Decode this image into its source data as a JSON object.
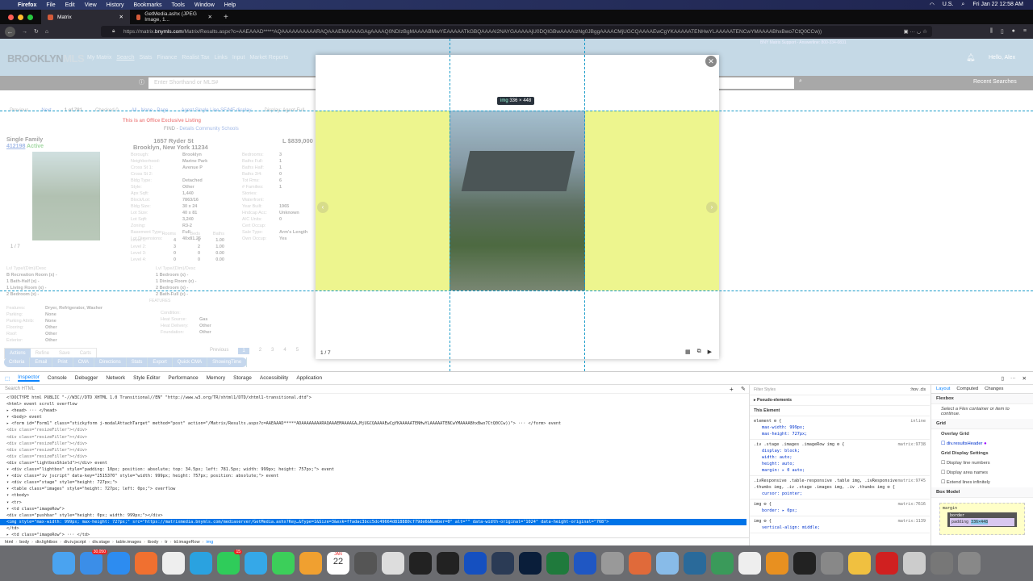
{
  "menubar": {
    "items": [
      "Firefox",
      "File",
      "Edit",
      "View",
      "History",
      "Bookmarks",
      "Tools",
      "Window",
      "Help"
    ],
    "locale": "U.S.",
    "clock": "Fri Jan 22  12:58 AM"
  },
  "tabs": [
    {
      "label": "Matrix"
    },
    {
      "label": "GetMedia.ashx (JPEG Image, 1..."
    }
  ],
  "url": {
    "prefix": "https://matrix.",
    "host": "bnymls.com",
    "path": "/Matrix/Results.aspx?c=AAEAAAD*****AQAAAAAAAAAARAQAAAEMAAAAGAgAAAAQ0NDIzBgMAAAABMwYEAAAAATkGBQAAAAI2NAYGAAAAAjU0DQIGBwAAAAIzNg0JBggAAAACMjUGCQAAAAEwCgYKAAAAATENHwYLAAAAATENCwYMAAAABhxBwo7CtQ0CCw))"
  },
  "header": {
    "logo_a": "BROOKLYN",
    "logo_b": "MLS",
    "nav": [
      "My Matrix",
      "Search",
      "Stats",
      "Finance",
      "Realist Tax",
      "Links",
      "Input",
      "Market Reports"
    ],
    "support": "BNY Matrix Support - Answerline: 800-334-0831",
    "user": "Hello, Alex",
    "search_placeholder": "Enter Shorthand or MLS#",
    "recent": "Recent Searches"
  },
  "results": {
    "pager": [
      "Previous",
      "Next",
      "1 of 781",
      "Checked 0",
      "All · None · Page",
      "Agent Single Line SF/MF display",
      "Display: Agent Full"
    ],
    "exclusive": "This is an Office Exclusive Listing",
    "find": "FIND -",
    "find_links": [
      "Details",
      "Community",
      "Schools"
    ],
    "type": "Single Family",
    "mls": "412198",
    "status": "Active",
    "address1": "1657 Ryder St",
    "address2": "Brooklyn, New York 11234",
    "price": "L $839,000",
    "photo_counter": "1 / 7",
    "details_left": [
      [
        "Borough:",
        "Brooklyn"
      ],
      [
        "Neighborhood:",
        "Marine Park"
      ],
      [
        "Cross St 1:",
        "Avenue P"
      ],
      [
        "Cross St 2:",
        ""
      ],
      [
        "Bldg Type:",
        "Detached"
      ],
      [
        "Style:",
        "Other"
      ],
      [
        "Apx Sqft:",
        "1,440"
      ],
      [
        "Block/Lot:",
        "7863/16"
      ],
      [
        "Bldg Size:",
        "30 x 24"
      ],
      [
        "Lot Size:",
        "40 x 81"
      ],
      [
        "Lot Sqft:",
        "3,240"
      ],
      [
        "Zoning:",
        "R3-2"
      ],
      [
        "Basement Type:",
        "Full"
      ],
      [
        "Lot Dimensions:",
        "40x81.25"
      ]
    ],
    "details_right": [
      [
        "Bedrooms:",
        "3"
      ],
      [
        "Baths Full:",
        "1"
      ],
      [
        "Baths Half:",
        "1"
      ],
      [
        "Baths 3/4:",
        "0"
      ],
      [
        "Tot Rms:",
        "6"
      ],
      [
        "# Families:",
        "1"
      ],
      [
        "Stories:",
        ""
      ],
      [
        "Waterfront:",
        ""
      ],
      [
        "Year Built:",
        "1965"
      ],
      [
        "Hndcap Acc:",
        "Unknown"
      ],
      [
        "A/C Units:",
        "0"
      ],
      [
        "Cert Occup:",
        ""
      ],
      [
        "Sale Type:",
        "Arm's Length"
      ],
      [
        "Own Occup:",
        "Yes"
      ]
    ],
    "levels_header": [
      "",
      "Rooms",
      "Beds",
      "Baths"
    ],
    "levels": [
      [
        "Level 1:",
        "4",
        "1",
        "1.00"
      ],
      [
        "Level 2:",
        "3",
        "2",
        "1.00"
      ],
      [
        "Level 3:",
        "0",
        "0",
        "0.00"
      ],
      [
        "Level 4:",
        "0",
        "0",
        "0.00"
      ]
    ],
    "rooms_header": "Lvl  Type/(Dim)/Desc",
    "rooms_left": [
      "B  Recreation Room (x) -",
      "1  Bath-Half (x) -",
      "1  Living Room (x) -",
      "2  Bedroom (x) -"
    ],
    "rooms_right": [
      "1  Bedroom (x) -",
      "1  Dining Room (x) -",
      "2  Bedroom (x) -",
      "2  Bath-Full (x) -"
    ],
    "features_title": "FEATURES",
    "features_left": [
      [
        "Features:",
        "Dryer, Refrigerator, Washer"
      ],
      [
        "Parking:",
        "None"
      ],
      [
        "Parking Attrib:",
        "None"
      ],
      [
        "Flooring:",
        "Other"
      ],
      [
        "Roof:",
        "Other"
      ],
      [
        "Exterior:",
        "Other"
      ]
    ],
    "features_right": [
      [
        "Condition:",
        ""
      ],
      [
        "",
        ""
      ],
      [
        "Heat Source:",
        "Gas"
      ],
      [
        "Heat Delivery:",
        "Other"
      ],
      [
        "Foundation:",
        "Other"
      ]
    ],
    "action_tabs": [
      "Actions",
      "Refine",
      "Save",
      "Carts"
    ],
    "actions": [
      "Criteria",
      "Email",
      "Print",
      "CMA",
      "Directions",
      "Stats",
      "Export",
      "Quick CMA",
      "ShowingTime"
    ],
    "pages": [
      "Previous",
      "1",
      "2",
      "3",
      "4",
      "5"
    ]
  },
  "lightbox": {
    "counter": "1 / 7",
    "tooltip_tag": "img",
    "tooltip_size": "336 × 448"
  },
  "devtools": {
    "tabs": [
      "Inspector",
      "Console",
      "Debugger",
      "Network",
      "Style Editor",
      "Performance",
      "Memory",
      "Storage",
      "Accessibility",
      "Application"
    ],
    "search_placeholder": "Search HTML",
    "markup": [
      "<!DOCTYPE html PUBLIC \"-//W3C//DTD XHTML 1.0 Transitional//EN\" \"http://www.w3.org/TR/xhtml1/DTD/xhtml1-transitional.dtd\">",
      "<html> event scroll overflow",
      "▸ <head> ··· </head>",
      "▾ <body> event",
      "  ▸ <form id=\"Form1\" class=\"stickyform j-modalAttachTarget\" method=\"post\" action=\"/Matrix/Results.aspx?c=AAEAAAD*****ADAAAAAAAARAQAAAEMAAAAGA…MjUGCQAAAAEwCgYKAAAAATENHwYLAAAAATENCwYMAAAABhxBwo7CtQ0CCw))\"> ··· </form> event",
      "    <div class=\"resizeFiller\"></div>",
      "    <div class=\"resizeFiller\"></div>",
      "    <div class=\"resizeFiller\"></div>",
      "    <div class=\"resizeFiller\"></div>",
      "    <div class=\"resizeFiller\"></div>",
      "    <div class=\"lightboxShield\"></div> event",
      "  ▾ <div class=\"lightbox\" style=\"padding: 10px; position: absolute; top: 34.5px; left: 781.5px; width: 999px; height: 757px;\"> event",
      "    ▾ <div class=\"iv jscript\" data-key=\"2515370\" style=\"width: 999px; height: 757px; position: absolute;\"> event",
      "      ▾ <div class=\"stage\" style=\"height: 727px;\">",
      "        ▾ <table class=\"images\" style=\"height: 727px; left: 0px;\"> overflow",
      "          ▾ <tbody>",
      "            ▾ <tr>",
      "              ▾ <td class=\"imageRow\">",
      "                  <div class=\"pushbar\" style=\"height: 0px; width: 999px;\"></div>",
      "                  <img style=\"max-width: 999px; max-height: 727px;\" src=\"https://matrixmedia.bnymls.com/mediaserver/GetMedia.ashx?Key…&Type=1&Size=3&exk=ffadac3bcc5dc49664d818880cf79de6&Number=0\" alt=\"\" data-width-original=\"1024\" data-height-original=\"768\">",
      "                </td>",
      "              ▸ <td class=\"imageRow\"> ··· </td>"
    ],
    "breadcrumbs": [
      "html",
      "body",
      "div.lightbox",
      "div.iv.jscript",
      "div.stage",
      "table.images",
      "tbody",
      "tr",
      "td.imageRow",
      "img"
    ],
    "styles_filter": "Filter Styles",
    "styles_tools": ":hov .cls",
    "styles": [
      {
        "sel": "▸ Pseudo-elements",
        "src": "",
        "props": []
      },
      {
        "sel": "This Element",
        "src": "",
        "props": []
      },
      {
        "sel": "element ⚙ {",
        "src": "inline",
        "props": [
          "max-width: 999px;",
          "max-height: 727px;"
        ]
      },
      {
        "sel": ".iv .stage .images .imageRow img ⚙ {",
        "src": "matrix:9738",
        "props": [
          "display: block;",
          "width: auto;",
          "height: auto;",
          "margin: ▸ 0 auto;"
        ]
      },
      {
        "sel": ".ivResponsive .table-responsive .table img, .ivResponsive .thumbs img, .iv .stage .images img, .iv .thumbs img ⚙ {",
        "src": "matrix:9745",
        "props": [
          "cursor: pointer;"
        ]
      },
      {
        "sel": "img ⚙ {",
        "src": "matrix:7616",
        "props": [
          "border: ▸ 0px;"
        ]
      },
      {
        "sel": "img ⚙ {",
        "src": "matrix:1139",
        "props": [
          "vertical-align: middle;"
        ]
      }
    ],
    "layout_tabs": [
      "Layout",
      "Computed",
      "Changes"
    ],
    "layout": {
      "flexbox": "Flexbox",
      "flex_msg": "Select a Flex container or item to continue.",
      "grid": "Grid",
      "overlay": "Overlay Grid",
      "grid_item": "div.resultsHeader",
      "grid_settings": "Grid Display Settings",
      "opts": [
        "Display line numbers",
        "Display area names",
        "Extend lines infinitely"
      ],
      "box": "Box Model",
      "margin": "margin",
      "border": "border",
      "padding": "padding",
      "content": "336×448"
    }
  },
  "dock": {
    "mail_badge": "30,050",
    "telegram_badge": "15",
    "calendar_month": "JAN",
    "calendar_day": "22"
  }
}
